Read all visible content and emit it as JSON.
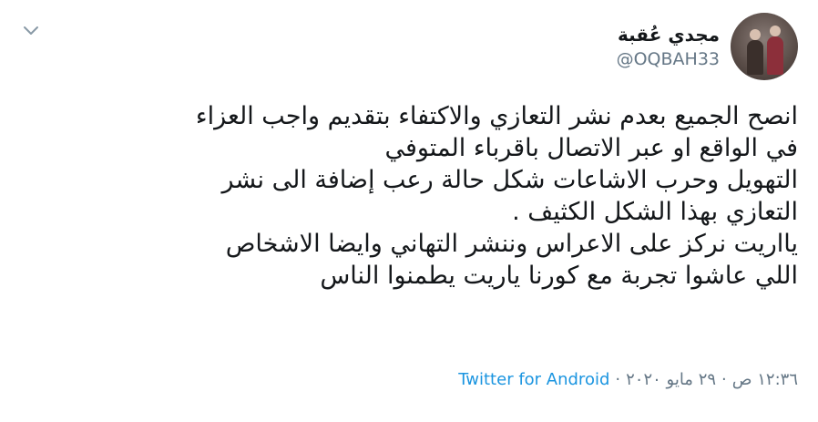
{
  "header": {
    "display_name": "مجدي عُقبة",
    "handle": "@OQBAH33"
  },
  "tweet": {
    "lines": [
      "انصح الجميع بعدم نشر التعازي والاكتفاء بتقديم واجب العزاء",
      "في الواقع او عبر الاتصال باقرباء المتوفي",
      "التهويل وحرب الاشاعات شكل حالة رعب إضافة الى نشر",
      "التعازي بهذا الشكل الكثيف .",
      "يااريت نركز على الاعراس وننشر التهاني وايضا الاشخاص",
      "اللي عاشوا تجربة مع كورنا ياريت يطمنوا الناس"
    ],
    "time": "١٢:٣٦ ص",
    "separator": "·",
    "date": "٢٩ مايو ٢٠٢٠",
    "source": "Twitter for Android"
  },
  "icons": {
    "menu": "chevron-down-icon",
    "avatar": "profile-photo"
  },
  "colors": {
    "text": "#14171a",
    "secondary": "#657786",
    "link": "#1b95e0"
  }
}
